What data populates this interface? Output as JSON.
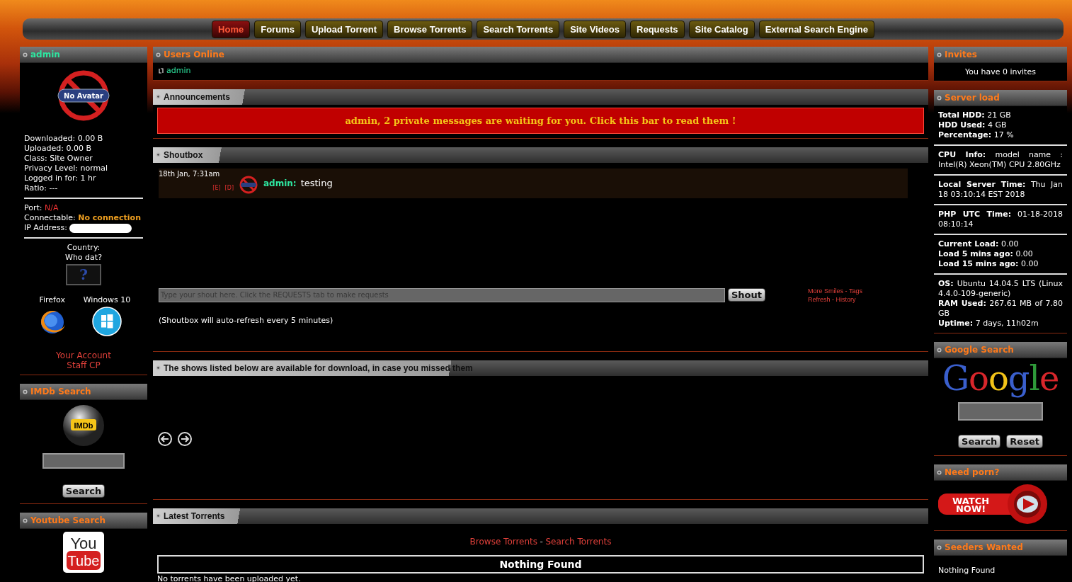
{
  "nav": [
    {
      "label": "Home",
      "selected": true
    },
    {
      "label": "Forums",
      "selected": false
    },
    {
      "label": "Upload Torrent",
      "selected": false
    },
    {
      "label": "Browse Torrents",
      "selected": false
    },
    {
      "label": "Search Torrents",
      "selected": false
    },
    {
      "label": "Site Videos",
      "selected": false
    },
    {
      "label": "Requests",
      "selected": false
    },
    {
      "label": "Site Catalog",
      "selected": false
    },
    {
      "label": "External Search Engine",
      "selected": false
    }
  ],
  "user_panel": {
    "title": "admin",
    "avatar_label": "No Avatar",
    "stats": [
      {
        "label": "Downloaded:",
        "value": "0.00 B"
      },
      {
        "label": "Uploaded:",
        "value": "0.00 B"
      },
      {
        "label": "Class:",
        "value": "Site Owner"
      },
      {
        "label": "Privacy Level:",
        "value": "normal"
      },
      {
        "label": "Logged in for:",
        "value": "1 hr"
      },
      {
        "label": "Ratio:",
        "value": "---"
      }
    ],
    "connection": [
      {
        "label": "Port:",
        "value": "N/A",
        "kind": "error"
      },
      {
        "label": "Connectable:",
        "value": "No connection",
        "kind": "warning"
      },
      {
        "label": "IP Address:",
        "kind": "redacted"
      }
    ],
    "country_label": "Country:",
    "country_value": "Who dat?",
    "flag": "?",
    "browsers": [
      {
        "label": "Firefox",
        "kind": "firefox"
      },
      {
        "label": "Windows 10",
        "kind": "windows"
      }
    ],
    "links": [
      "Your Account",
      "Staff CP"
    ]
  },
  "imdb_search": {
    "title": "IMDb Search",
    "logo": "IMDb",
    "button": "Search"
  },
  "youtube_search": {
    "title": "Youtube Search",
    "logo_top": "You",
    "logo_bottom": "Tube"
  },
  "users_online": {
    "title": "Users Online",
    "users": [
      "admin"
    ]
  },
  "announcements": {
    "title": "Announcements",
    "message": "admin, 2 private messages are waiting for you.  Click this bar to read them !"
  },
  "shoutbox": {
    "title": "Shoutbox",
    "messages": [
      {
        "time": "18th Jan, 7:31am",
        "actions": [
          "[E]",
          "[D]"
        ],
        "author": "admin:",
        "text": "testing"
      }
    ],
    "placeholder": "Type your shout here. Click the REQUESTS tab to make requests",
    "button": "Shout",
    "link_rows": [
      [
        "More Smiles",
        "Tags"
      ],
      [
        "Refresh",
        "History"
      ]
    ],
    "separator": "-",
    "note": "(Shoutbox will auto-refresh every 5 minutes)"
  },
  "shows": {
    "title": "The shows listed below are available for download, in case you missed them"
  },
  "latest_torrents": {
    "title": "Latest Torrents",
    "links": [
      "Browse Torrents",
      "Search Torrents"
    ],
    "separator": "-",
    "heading": "Nothing Found",
    "message": "No torrents have been uploaded yet."
  },
  "invites": {
    "title": "Invites",
    "text": "You have 0 invites"
  },
  "server_load": {
    "title": "Server load",
    "groups": [
      [
        {
          "label": "Total HDD:",
          "value": "21 GB"
        },
        {
          "label": "HDD Used:",
          "value": "4 GB"
        },
        {
          "label": "Percentage:",
          "value": "17 %"
        }
      ],
      [
        {
          "label": "CPU Info:",
          "value": "model name : Intel(R) Xeon(TM) CPU 2.80GHz"
        }
      ],
      [
        {
          "label": "Local Server Time:",
          "value": "Thu Jan 18 03:10:14 EST 2018"
        }
      ],
      [
        {
          "label": "PHP UTC Time:",
          "value": "01-18-2018 08:10:14"
        }
      ],
      [
        {
          "label": "Current Load:",
          "value": "0.00"
        },
        {
          "label": "Load 5 mins ago:",
          "value": "0.00"
        },
        {
          "label": "Load 15 mins ago:",
          "value": "0.00"
        }
      ],
      [
        {
          "label": "OS:",
          "value": "Ubuntu 14.04.5 LTS (Linux 4.4.0-109-generic)"
        },
        {
          "label": "RAM Used:",
          "value": "267.61 MB of 7.80 GB"
        },
        {
          "label": "Uptime:",
          "value": "7 days, 11h02m"
        }
      ]
    ]
  },
  "google_search": {
    "title": "Google Search",
    "logo": "Google",
    "buttons": [
      "Search",
      "Reset"
    ]
  },
  "ad": {
    "title": "Need porn?",
    "lines": [
      "WATCH",
      "NOW!"
    ]
  },
  "seeders_wanted": {
    "title": "Seeders Wanted",
    "text": "Nothing Found"
  }
}
